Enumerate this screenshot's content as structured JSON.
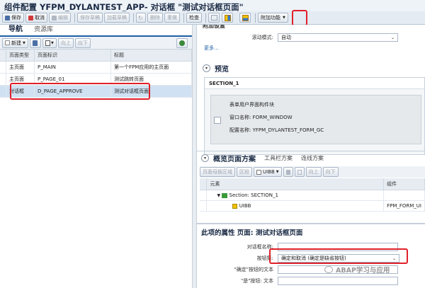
{
  "window": {
    "title": "组件配置 YFPM_DYLANTEST_APP- 对话框 \"测试对话框页面\""
  },
  "toolbar": {
    "save": "保存",
    "cancel": "取消",
    "edit": "编辑",
    "save_draft": "保存草稿",
    "load_draft": "加载草稿",
    "delete": "删除",
    "redo": "重做",
    "check": "检查",
    "extras": "附加功能"
  },
  "nav": {
    "tabs": [
      "导航",
      "资源库"
    ],
    "new_label": "新建",
    "up_label": "向上",
    "down_label": "向下",
    "columns": [
      "页面类型",
      "页面标识",
      "标题"
    ],
    "rows": [
      [
        "主页面",
        "P_MAIN",
        "第一个FPM应用的主页面"
      ],
      [
        "主页面",
        "P_PAGE_01",
        "测试跳转页面"
      ],
      [
        "对话框",
        "D_PAGE_APPROVE",
        "测试对话框页面"
      ]
    ]
  },
  "general": {
    "label_partial": "附加设置",
    "scroll_label": "滚动模式:",
    "scroll_value": "自动",
    "more": "更多..."
  },
  "preview": {
    "title": "预览",
    "section": "SECTION_1",
    "line1": "表单用户界面构件块",
    "line2_label": "窗口名称:",
    "line2_value": "FORM_WINDOW",
    "line3_label": "配置名称:",
    "line3_value": "YFPM_DYLANTEST_FORM_GC"
  },
  "schema": {
    "tabs": [
      "概览页面方案",
      "工具栏方案",
      "连线方案"
    ],
    "btn_page_area": "页面母板区域",
    "btn_section": "区段",
    "btn_uibb": "UIBB",
    "btn_up": "向上",
    "btn_down": "向下",
    "col_element": "元素",
    "col_component": "组件",
    "row_section": "Section: SECTION_1",
    "row_uibb": "UIBB",
    "row_uibb_comp": "FPM_FORM_UI"
  },
  "props": {
    "title": "此项的属性 页面: 测试对话框页面",
    "dialog_name_label": "对话框名称:",
    "buttonset_label": "按钮集:",
    "buttonset_value": "确定和取消 (确定是缺省按钮)",
    "ok_text_label": "\"确定\"按钮的文本",
    "yes_text_label": "\"是\"按钮: 文本"
  },
  "watermark": "ABAP学习与应用"
}
